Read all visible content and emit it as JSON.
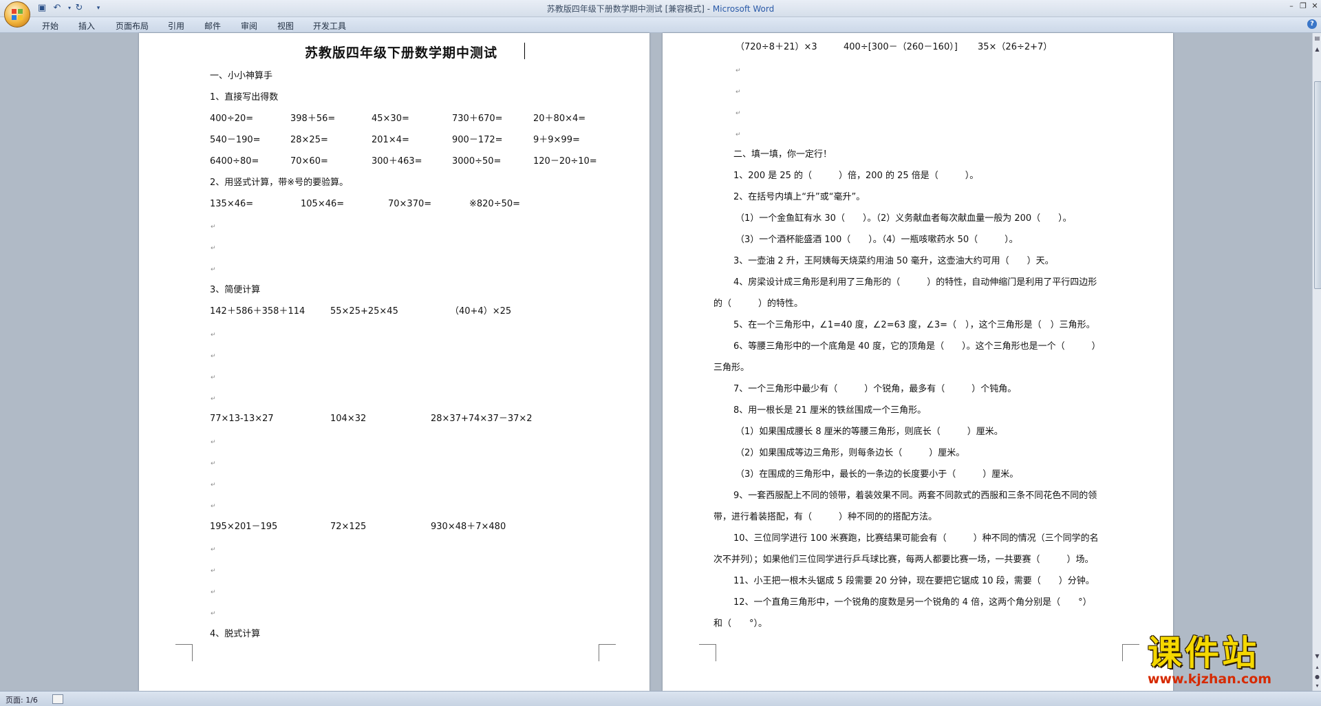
{
  "window": {
    "title": "苏教版四年级下册数学期中测试 [兼容模式] - ",
    "app_name": "Microsoft Word",
    "help_label": "?"
  },
  "quick_access": {
    "save_icon": "save-icon",
    "undo_icon": "undo-icon",
    "redo_icon": "redo-icon"
  },
  "ribbon": {
    "tabs": [
      "开始",
      "插入",
      "页面布局",
      "引用",
      "邮件",
      "审阅",
      "视图",
      "开发工具"
    ]
  },
  "paragraph_mark": "↵",
  "page1": {
    "title": "苏教版四年级下册数学期中测试",
    "s1": "一、小小神算手",
    "s1_1": "1、直接写出得数",
    "row1": [
      "400÷20=",
      "398＋56=",
      "45×30=",
      "730＋670=",
      "20＋80×4="
    ],
    "row2": [
      "540－190=",
      "28×25=",
      "201×4=",
      "900－172=",
      "9＋9×99="
    ],
    "row3": [
      "6400÷80=",
      "70×60=",
      "300＋463=",
      "3000÷50=",
      "120－20÷10="
    ],
    "s1_2": "2、用竖式计算，带※号的要验算。",
    "vert": [
      "135×46=",
      "105×46=",
      "70×370=",
      "※820÷50="
    ],
    "s1_3": "3、简便计算",
    "simp1": [
      "142＋586＋358＋114",
      "55×25+25×45",
      "（40+4）×25"
    ],
    "simp2": [
      "77×13-13×27",
      "104×32",
      "28×37+74×37－37×2"
    ],
    "simp3": [
      "195×201－195",
      "72×125",
      "930×48＋7×480"
    ],
    "s1_4": "4、脱式计算"
  },
  "page2": {
    "calc": [
      "（720÷8＋21）×3",
      "400÷[300－（260－160）]",
      "35×（26÷2+7）"
    ],
    "s2": "二、填一填，你一定行！",
    "q1": "1、200 是 25 的（　　　）倍，200 的 25 倍是（　　　）。",
    "q2": "2、在括号内填上“升”或“毫升”。",
    "q2a": "（1）一个金鱼缸有水 30（　　）。（2）义务献血者每次献血量一般为 200（　　）。",
    "q2b": "（3）一个酒杯能盛酒 100（　　）。（4）一瓶咳嗽药水 50（　　　）。",
    "q3": "3、一壶油 2 升，王阿姨每天烧菜约用油 50 毫升，这壶油大约可用（　　）天。",
    "q4a": "4、房梁设计成三角形是利用了三角形的（　　　）的特性，自动伸缩门是利用了平行四边形",
    "q4b": "的（　　　）的特性。",
    "q5": "5、在一个三角形中，∠1=40 度，∠2=63 度，∠3=（　），这个三角形是（　）三角形。",
    "q6a": "6、等腰三角形中的一个底角是 40 度，它的顶角是（　　）。这个三角形也是一个（　　　）",
    "q6b": "三角形。",
    "q7": "7、一个三角形中最少有（　　　）个锐角，最多有（　　　）个钝角。",
    "q8": "8、用一根长是 21 厘米的铁丝围成一个三角形。",
    "q8a": "（1）如果围成腰长 8 厘米的等腰三角形，则底长（　　　）厘米。",
    "q8b": "（2）如果围成等边三角形，则每条边长（　　　）厘米。",
    "q8c": "（3）在围成的三角形中，最长的一条边的长度要小于（　　　）厘米。",
    "q9a": "9、一套西服配上不同的领带，着装效果不同。两套不同款式的西服和三条不同花色不同的领",
    "q9b": "带，进行着装搭配，有（　　　）种不同的的搭配方法。",
    "q10a": "10、三位同学进行 100 米赛跑，比赛结果可能会有（　　　）种不同的情况（三个同学的名",
    "q10b": "次不并列）；如果他们三位同学进行乒乓球比赛，每两人都要比赛一场，一共要赛（　　　）场。",
    "q11": "11、小王把一根木头锯成 5 段需要 20 分钟，现在要把它锯成 10 段，需要（　　）分钟。",
    "q12a": "12、一个直角三角形中，一个锐角的度数是另一个锐角的 4 倍，这两个角分别是（　　°）",
    "q12b": "和（　　°）。"
  },
  "status_bar": {
    "page_info": "页面: 1/6"
  },
  "watermark": {
    "main": "课件站",
    "url": "www.kjzhan.com"
  }
}
